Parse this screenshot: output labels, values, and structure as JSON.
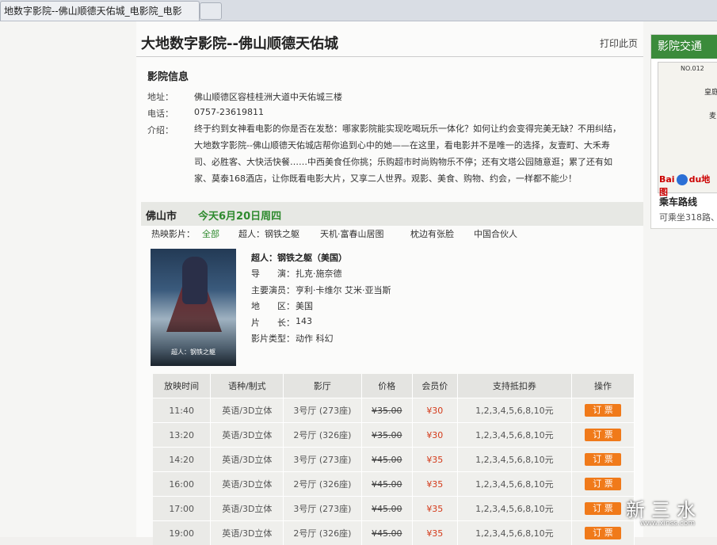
{
  "browser": {
    "tab_title": "地数字影院--佛山顺德天佑城_电影院_电影"
  },
  "header": {
    "title": "大地数字影院--佛山顺德天佑城",
    "print_label": "打印此页"
  },
  "cinema_info": {
    "section_title": "影院信息",
    "address_label": "地址：",
    "address": "佛山顺德区容桂桂洲大道中天佑城三楼",
    "phone_label": "电话：",
    "phone": "0757-23619811",
    "intro_label": "介绍：",
    "intro": "终于约到女神看电影的你是否在发愁：哪家影院能实现吃喝玩乐一体化？如何让约会变得完美无缺？不用纠结，大地数字影院--佛山顺德天佑城店帮你追到心中的她——在这里，看电影并不是唯一的选择，友壹町、大禾寿司、必胜客、大快活快餐……中西美食任你挑；乐购超市时尚购物乐不停；还有文塔公园随意逛；累了还有如家、莫泰168酒店，让你既看电影大片，又享二人世界。观影、美食、购物、约会，一样都不能少！"
  },
  "schedule_bar": {
    "city": "佛山市",
    "date": "今天6月20日周四"
  },
  "hot_movies": {
    "label": "热映影片：",
    "items": [
      "全部",
      "超人：钢铁之躯",
      "天机·富春山居图",
      "枕边有张脸",
      "中国合伙人"
    ]
  },
  "movie": {
    "title": "超人：钢铁之躯（美国）",
    "poster_text": "超人：钢铁之躯",
    "director_label": "导　　演：",
    "director": "扎克·施奈德",
    "cast_label": "主要演员：",
    "cast": "亨利·卡维尔 艾米·亚当斯",
    "region_label": "地　　区：",
    "region": "美国",
    "length_label": "片　　长：",
    "length": "143",
    "genre_label": "影片类型：",
    "genre": "动作 科幻"
  },
  "table": {
    "headers": [
      "放映时间",
      "语种/制式",
      "影厅",
      "价格",
      "会员价",
      "支持抵扣券",
      "操作"
    ],
    "rows": [
      {
        "time": "11:40",
        "lang": "英语/3D立体",
        "hall": "3号厅 (273座)",
        "price": "¥35.00",
        "member": "¥30",
        "coupons": "1,2,3,4,5,6,8,10元",
        "action": "订 票"
      },
      {
        "time": "13:20",
        "lang": "英语/3D立体",
        "hall": "2号厅 (326座)",
        "price": "¥35.00",
        "member": "¥30",
        "coupons": "1,2,3,4,5,6,8,10元",
        "action": "订 票"
      },
      {
        "time": "14:20",
        "lang": "英语/3D立体",
        "hall": "3号厅 (273座)",
        "price": "¥45.00",
        "member": "¥35",
        "coupons": "1,2,3,4,5,6,8,10元",
        "action": "订 票"
      },
      {
        "time": "16:00",
        "lang": "英语/3D立体",
        "hall": "2号厅 (326座)",
        "price": "¥45.00",
        "member": "¥35",
        "coupons": "1,2,3,4,5,6,8,10元",
        "action": "订 票"
      },
      {
        "time": "17:00",
        "lang": "英语/3D立体",
        "hall": "3号厅 (273座)",
        "price": "¥45.00",
        "member": "¥35",
        "coupons": "1,2,3,4,5,6,8,10元",
        "action": "订 票"
      },
      {
        "time": "19:00",
        "lang": "英语/3D立体",
        "hall": "2号厅 (326座)",
        "price": "¥45.00",
        "member": "¥35",
        "coupons": "1,2,3,4,5,6,8,10元",
        "action": "订 票"
      }
    ]
  },
  "sidebar": {
    "title": "影院交通",
    "map_no": "NO.012",
    "map_text1": "皇庭",
    "map_text2": "麦",
    "baidu": "Bai",
    "baidu2": "du地图",
    "route_title": "乘车路线",
    "route_text": "可乘坐318路、"
  },
  "watermark": {
    "text": "新三水",
    "sub": "www.xinss.com"
  }
}
